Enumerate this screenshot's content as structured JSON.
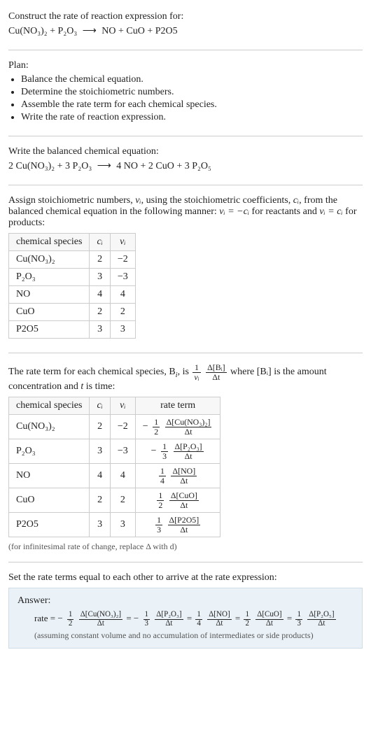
{
  "prompt": {
    "line1": "Construct the rate of reaction expression for:",
    "equation_lhs": "Cu(NO₃)₂ + P₂O₃",
    "arrow": "⟶",
    "equation_rhs": "NO + CuO + P2O5"
  },
  "plan": {
    "heading": "Plan:",
    "items": [
      "Balance the chemical equation.",
      "Determine the stoichiometric numbers.",
      "Assemble the rate term for each chemical species.",
      "Write the rate of reaction expression."
    ]
  },
  "balanced": {
    "heading": "Write the balanced chemical equation:",
    "lhs": "2 Cu(NO₃)₂ + 3 P₂O₃",
    "arrow": "⟶",
    "rhs": "4 NO + 2 CuO + 3 P₂O₅"
  },
  "assign": {
    "text_a": "Assign stoichiometric numbers, ",
    "nu": "νᵢ",
    "text_b": ", using the stoichiometric coefficients, ",
    "c": "cᵢ",
    "text_c": ", from the balanced chemical equation in the following manner: ",
    "rel1": "νᵢ = −cᵢ",
    "text_d": " for reactants and ",
    "rel2": "νᵢ = cᵢ",
    "text_e": " for products:"
  },
  "table1": {
    "headers": [
      "chemical species",
      "cᵢ",
      "νᵢ"
    ],
    "rows": [
      {
        "species": "Cu(NO₃)₂",
        "c": "2",
        "nu": "−2"
      },
      {
        "species": "P₂O₃",
        "c": "3",
        "nu": "−3"
      },
      {
        "species": "NO",
        "c": "4",
        "nu": "4"
      },
      {
        "species": "CuO",
        "c": "2",
        "nu": "2"
      },
      {
        "species": "P2O5",
        "c": "3",
        "nu": "3"
      }
    ]
  },
  "rate_text": {
    "a": "The rate term for each chemical species, B",
    "sub_i": "i",
    "b": ", is ",
    "frac1_num": "1",
    "frac1_den": "νᵢ",
    "frac2_num": "Δ[Bᵢ]",
    "frac2_den": "Δt",
    "c": " where [Bᵢ] is the amount concentration and ",
    "t": "t",
    "d": " is time:"
  },
  "table2": {
    "headers": [
      "chemical species",
      "cᵢ",
      "νᵢ",
      "rate term"
    ],
    "rows": [
      {
        "species": "Cu(NO₃)₂",
        "c": "2",
        "nu": "−2",
        "sign": "−",
        "coef_num": "1",
        "coef_den": "2",
        "d_num": "Δ[Cu(NO₃)₂]",
        "d_den": "Δt"
      },
      {
        "species": "P₂O₃",
        "c": "3",
        "nu": "−3",
        "sign": "−",
        "coef_num": "1",
        "coef_den": "3",
        "d_num": "Δ[P₂O₃]",
        "d_den": "Δt"
      },
      {
        "species": "NO",
        "c": "4",
        "nu": "4",
        "sign": "",
        "coef_num": "1",
        "coef_den": "4",
        "d_num": "Δ[NO]",
        "d_den": "Δt"
      },
      {
        "species": "CuO",
        "c": "2",
        "nu": "2",
        "sign": "",
        "coef_num": "1",
        "coef_den": "2",
        "d_num": "Δ[CuO]",
        "d_den": "Δt"
      },
      {
        "species": "P2O5",
        "c": "3",
        "nu": "3",
        "sign": "",
        "coef_num": "1",
        "coef_den": "3",
        "d_num": "Δ[P2O5]",
        "d_den": "Δt"
      }
    ],
    "caption": "(for infinitesimal rate of change, replace Δ with d)"
  },
  "set_equal": "Set the rate terms equal to each other to arrive at the rate expression:",
  "answer": {
    "label": "Answer:",
    "lead": "rate = ",
    "terms": [
      {
        "sign": "−",
        "coef_num": "1",
        "coef_den": "2",
        "d_num": "Δ[Cu(NO₃)₂]",
        "d_den": "Δt"
      },
      {
        "sign": "−",
        "coef_num": "1",
        "coef_den": "3",
        "d_num": "Δ[P₂O₃]",
        "d_den": "Δt"
      },
      {
        "sign": "",
        "coef_num": "1",
        "coef_den": "4",
        "d_num": "Δ[NO]",
        "d_den": "Δt"
      },
      {
        "sign": "",
        "coef_num": "1",
        "coef_den": "2",
        "d_num": "Δ[CuO]",
        "d_den": "Δt"
      },
      {
        "sign": "",
        "coef_num": "1",
        "coef_den": "3",
        "d_num": "Δ[P₂O₅]",
        "d_den": "Δt"
      }
    ],
    "eq": " = ",
    "assumption": "(assuming constant volume and no accumulation of intermediates or side products)"
  }
}
